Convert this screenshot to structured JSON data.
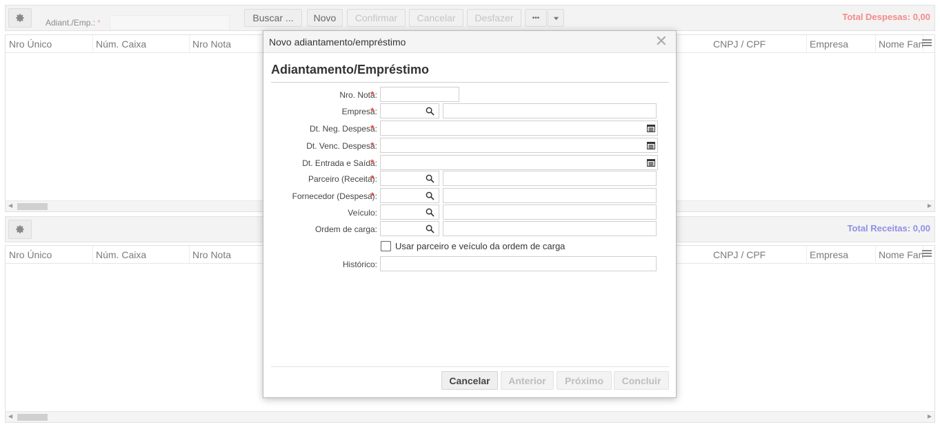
{
  "toolbar": {
    "field_label": "Adiant./Emp.:",
    "field_required": "*",
    "buttons": {
      "buscar": "Buscar ...",
      "novo": "Novo",
      "confirmar": "Confirmar",
      "cancelar": "Cancelar",
      "desfazer": "Desfazer",
      "more": "•••"
    },
    "total_despesas": "Total Despesas: 0,00",
    "total_receitas": "Total Receitas: 0,00"
  },
  "grid_columns": [
    "Nro Único",
    "Núm. Caixa",
    "Nro Nota",
    "CNPJ / CPF",
    "Empresa",
    "Nome Fantasia"
  ],
  "modal": {
    "title": "Novo adiantamento/empréstimo",
    "section_title": "Adiantamento/Empréstimo",
    "required_mark": "*",
    "fields": {
      "nro_nota": "Nro. Nota:",
      "empresa": "Empresa:",
      "dt_neg": "Dt. Neg. Despesa:",
      "dt_venc": "Dt. Venc. Despesa:",
      "dt_entrada": "Dt. Entrada e Saída:",
      "parceiro": "Parceiro (Receita):",
      "fornecedor": "Fornecedor (Despesa):",
      "veiculo": "Veículo:",
      "ordem": "Ordem de carga:",
      "historico": "Histórico:"
    },
    "checkbox_label": "Usar parceiro e veículo da ordem de carga",
    "buttons": {
      "cancelar": "Cancelar",
      "anterior": "Anterior",
      "proximo": "Próximo",
      "concluir": "Concluir"
    }
  },
  "colors": {
    "total_despesas": "#f58a8a",
    "total_receitas": "#8f8fe6",
    "required": "#e04848"
  }
}
